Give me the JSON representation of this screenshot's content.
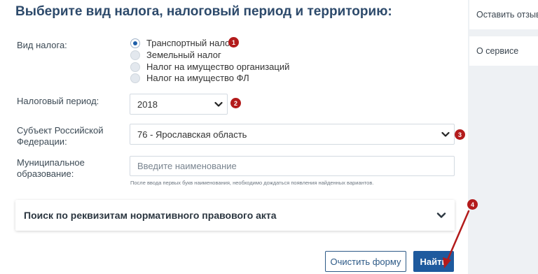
{
  "title": "Выберите вид налога, налоговый период и территорию:",
  "tax_type": {
    "label": "Вид налога:",
    "options": [
      {
        "label": "Транспортный налог",
        "checked": true
      },
      {
        "label": "Земельный налог",
        "checked": false
      },
      {
        "label": "Налог на имущество организаций",
        "checked": false
      },
      {
        "label": "Налог на имущество ФЛ",
        "checked": false
      }
    ]
  },
  "tax_period": {
    "label": "Налоговый период:",
    "value": "2018"
  },
  "region": {
    "label_line1": "Субъект Российской",
    "label_line2": "Федерации:",
    "value": "76 - Ярославская область"
  },
  "municipality": {
    "label_line1": "Муниципальное",
    "label_line2": "образование:",
    "placeholder": "Введите наименование",
    "hint": "После ввода первых букв наименования, необходимо дождаться появления найденных вариантов."
  },
  "accordion": {
    "title": "Поиск по реквизитам нормативного правового акта"
  },
  "buttons": {
    "clear": "Очистить форму",
    "find": "Найти"
  },
  "sidebar": {
    "feedback": "Оставить отзыв",
    "about": "О сервисе"
  },
  "badges": [
    "1",
    "2",
    "3",
    "4"
  ],
  "colors": {
    "accent": "#1e5a9e",
    "badge": "#b31b1b",
    "title": "#2d4a6b"
  }
}
